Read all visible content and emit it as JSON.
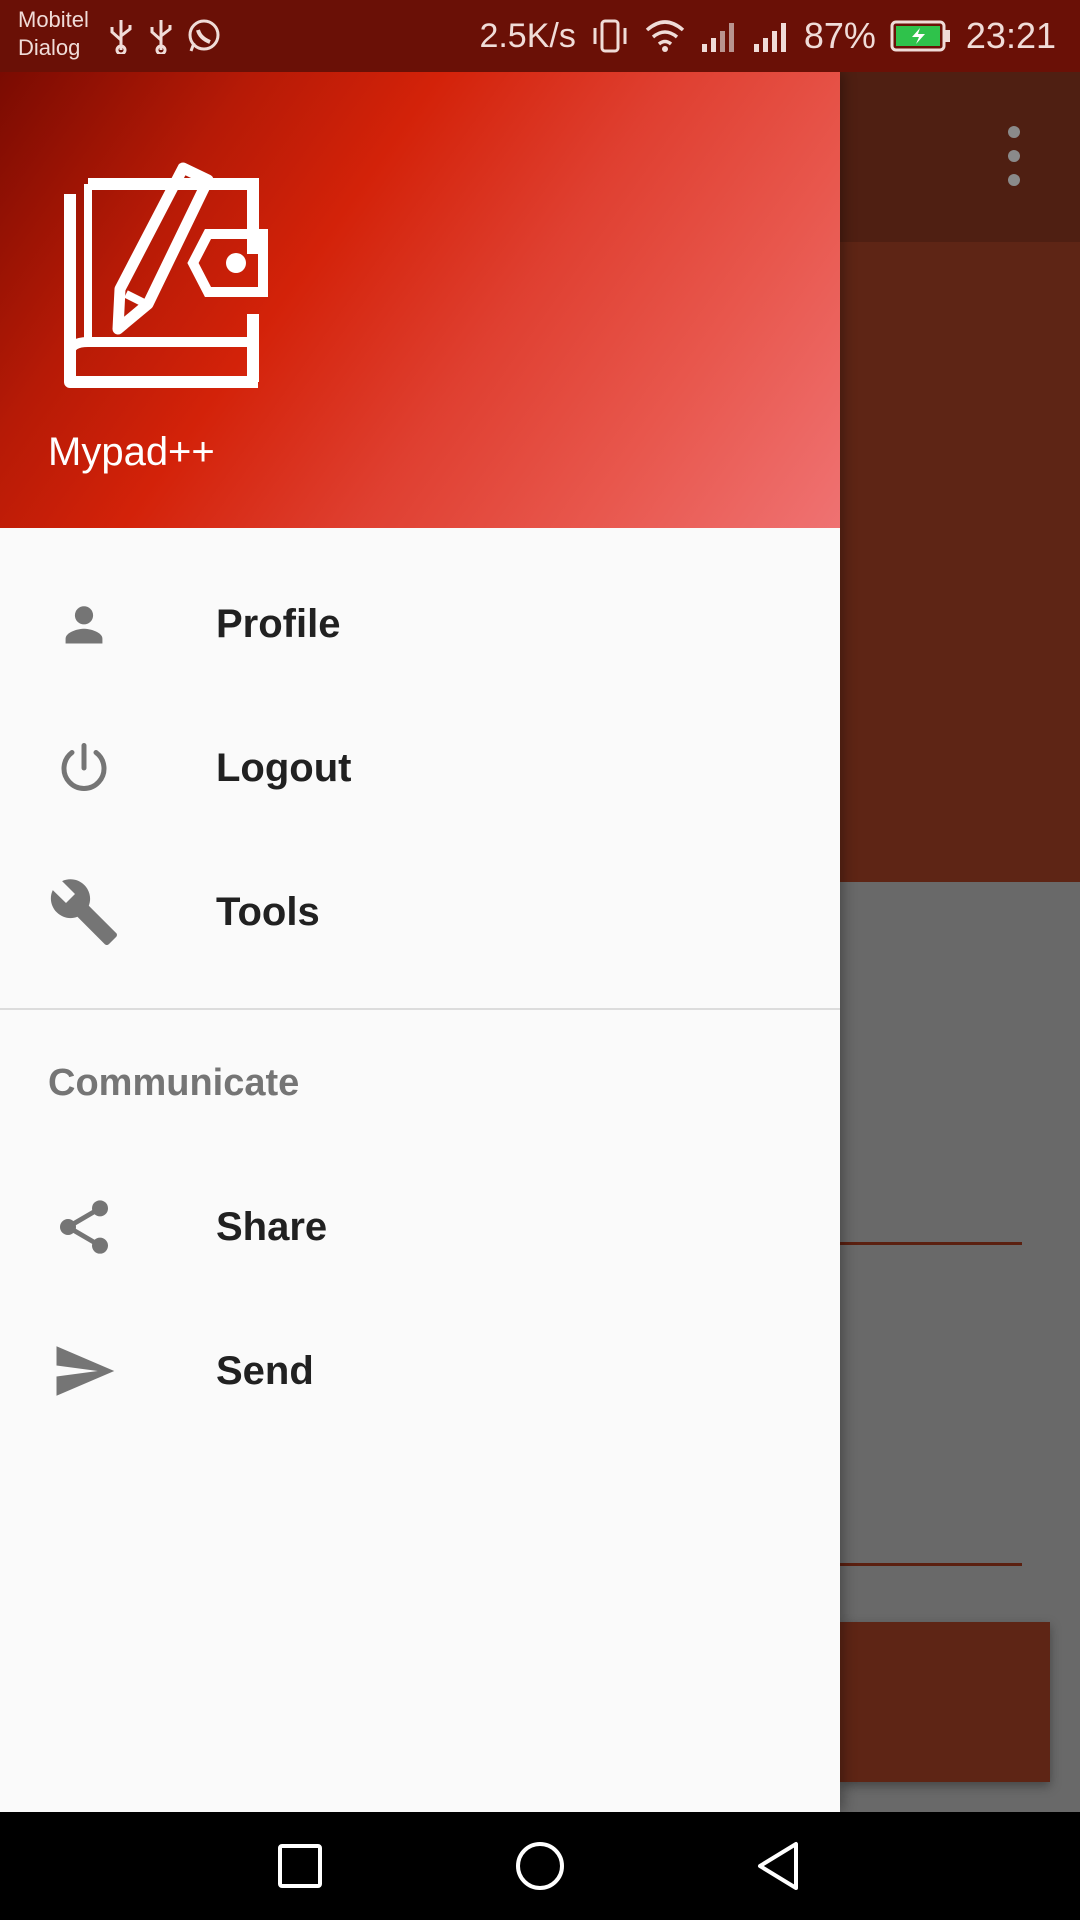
{
  "status_bar": {
    "carrier_1": "Mobitel",
    "carrier_2": "Dialog",
    "net_speed": "2.5K/s",
    "battery": "87%",
    "time": "23:21",
    "icons": [
      "usb-icon",
      "usb-icon",
      "whatsapp-icon",
      "vibrate-icon",
      "wifi-icon",
      "signal-icon",
      "signal-icon",
      "battery-charging-icon"
    ]
  },
  "drawer": {
    "header": {
      "app_name": "Mypad++",
      "logo_icon": "notebook-pen-icon"
    },
    "items": [
      {
        "label": "Profile",
        "icon": "person-icon"
      },
      {
        "label": "Logout",
        "icon": "power-icon"
      },
      {
        "label": "Tools",
        "icon": "wrench-icon"
      }
    ],
    "section_title": "Communicate",
    "section_items": [
      {
        "label": "Share",
        "icon": "share-icon"
      },
      {
        "label": "Send",
        "icon": "send-icon"
      }
    ]
  },
  "background_app": {
    "toolbar_icon": "overflow-menu-icon"
  },
  "navigation_bar": {
    "buttons": [
      "recents-icon",
      "home-icon",
      "back-icon"
    ]
  },
  "colors": {
    "header_gradient_start": "#7a0b02",
    "header_gradient_end": "#ef7272",
    "status_bar": "#6a1006",
    "menu_text": "#212121",
    "icon_gray": "#757575",
    "section_text": "#757575"
  }
}
